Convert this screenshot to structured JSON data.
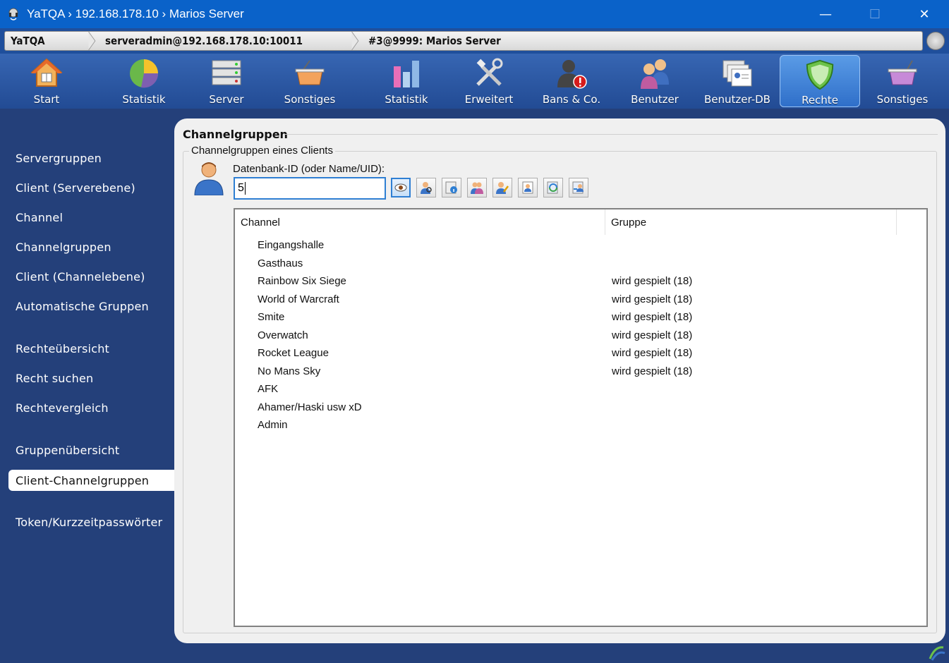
{
  "window": {
    "title": "YaTQA › 192.168.178.10 › Marios Server",
    "controls": {
      "minimize": "—",
      "maximize": "☐",
      "close": "✕"
    }
  },
  "breadcrumb": {
    "items": [
      {
        "label": "YaTQA"
      },
      {
        "label": "serveradmin@192.168.178.10:10011"
      },
      {
        "label": "#3@9999: Marios Server"
      }
    ]
  },
  "toolbar": {
    "items": [
      {
        "label": "Start",
        "icon": "house-icon"
      },
      {
        "label": "Statistik",
        "icon": "pie-chart-icon"
      },
      {
        "label": "Server",
        "icon": "server-rack-icon"
      },
      {
        "label": "Sonstiges",
        "icon": "basket-icon"
      },
      {
        "label": "Statistik",
        "icon": "bar-chart-icon"
      },
      {
        "label": "Erweitert",
        "icon": "tools-icon"
      },
      {
        "label": "Bans & Co.",
        "icon": "banned-user-icon"
      },
      {
        "label": "Benutzer",
        "icon": "users-icon"
      },
      {
        "label": "Benutzer-DB",
        "icon": "user-cards-icon"
      },
      {
        "label": "Rechte",
        "icon": "shield-icon",
        "active": true
      },
      {
        "label": "Sonstiges",
        "icon": "basket-icon"
      }
    ]
  },
  "sidebar": {
    "items": [
      {
        "label": "Servergruppen"
      },
      {
        "label": "Client (Serverebene)"
      },
      {
        "label": "Channel"
      },
      {
        "label": "Channelgruppen"
      },
      {
        "label": "Client (Channelebene)"
      },
      {
        "label": "Automatische Gruppen"
      },
      {
        "label": "Rechteübersicht"
      },
      {
        "label": "Recht suchen"
      },
      {
        "label": "Rechtevergleich"
      },
      {
        "label": "Gruppenübersicht"
      },
      {
        "label": "Client-Channelgruppen",
        "active": true
      },
      {
        "label": "Token/Kurzzeitpasswörter"
      }
    ]
  },
  "main": {
    "title": "Channelgruppen",
    "group_title": "Channelgruppen eines Clients",
    "field_label": "Datenbank-ID (oder Name/UID):",
    "field_value": "5",
    "buttons": [
      {
        "icon": "eye-icon"
      },
      {
        "icon": "user-search-icon"
      },
      {
        "icon": "user-info-icon"
      },
      {
        "icon": "user-group-icon"
      },
      {
        "icon": "user-edit-icon"
      },
      {
        "icon": "user-card-icon"
      },
      {
        "icon": "user-refresh-icon"
      },
      {
        "icon": "user-transfer-icon"
      }
    ],
    "table": {
      "columns": [
        "Channel",
        "Gruppe"
      ],
      "rows": [
        {
          "channel": "Eingangshalle",
          "group": ""
        },
        {
          "channel": "Gasthaus",
          "group": ""
        },
        {
          "channel": "Rainbow Six Siege",
          "group": "wird gespielt (18)"
        },
        {
          "channel": "World of Warcraft",
          "group": "wird gespielt (18)"
        },
        {
          "channel": "Smite",
          "group": "wird gespielt (18)"
        },
        {
          "channel": "Overwatch",
          "group": "wird gespielt (18)"
        },
        {
          "channel": "Rocket League",
          "group": "wird gespielt (18)"
        },
        {
          "channel": "No Mans Sky",
          "group": "wird gespielt (18)"
        },
        {
          "channel": "AFK",
          "group": ""
        },
        {
          "channel": "Ahamer/Haski usw xD",
          "group": ""
        },
        {
          "channel": "Admin",
          "group": ""
        }
      ]
    }
  },
  "colors": {
    "titlebar": "#0a62c9",
    "background": "#24407a",
    "accent": "#2f7fd3",
    "panel": "#f0f0f0"
  }
}
